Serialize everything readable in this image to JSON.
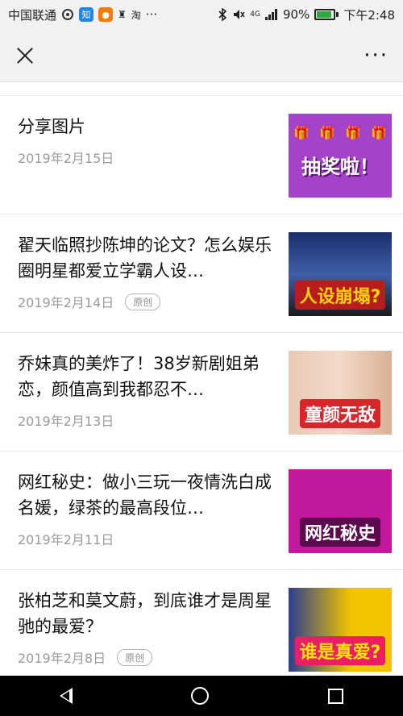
{
  "status_bar": {
    "carrier": "中国联通",
    "left_icons": [
      "weibo-icon",
      "zhihu-icon",
      "app-icon",
      "app2-icon",
      "taobao-icon"
    ],
    "zhihu_text": "知",
    "taobao_text": "淘",
    "more_dots": "···",
    "network": "4G",
    "battery": "90%",
    "battery_level": 0.9,
    "time": "下午2:48"
  },
  "title_bar": {
    "more_label": "···"
  },
  "articles": [
    {
      "title": "分享图片",
      "date": "2019年2月15日",
      "badge": "",
      "thumb_text": "抽奖啦！"
    },
    {
      "title": "翟天临照抄陈坤的论文？怎么娱乐圈明星都爱立学霸人设…",
      "date": "2019年2月14日",
      "badge": "原创",
      "thumb_text": "人设崩塌?"
    },
    {
      "title": "乔妹真的美炸了！38岁新剧姐弟恋，颜值高到我都忍不…",
      "date": "2019年2月13日",
      "badge": "",
      "thumb_text": "童颜无敌"
    },
    {
      "title": "网红秘史：做小三玩一夜情洗白成名媛，绿茶的最高段位…",
      "date": "2019年2月11日",
      "badge": "",
      "thumb_text": "网红秘史"
    },
    {
      "title": "张柏芝和莫文蔚，到底谁才是周星驰的最爱？",
      "date": "2019年2月8日",
      "badge": "原创",
      "thumb_text": "谁是真爱?"
    }
  ],
  "colors": {
    "status_bg": "#f1f1f1",
    "battery_green": "#2eaa3a",
    "nav_bg": "#000000",
    "meta_grey": "#9a9a9a"
  }
}
